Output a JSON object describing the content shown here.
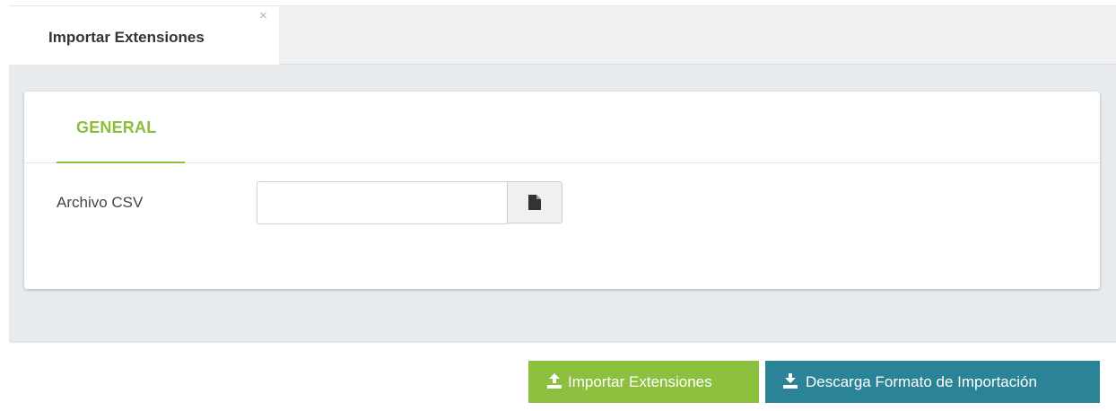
{
  "window_tab": {
    "title": "Importar Extensiones",
    "close_glyph": "×",
    "close_icon": "close-icon"
  },
  "panel": {
    "tabs": [
      {
        "label": "GENERAL",
        "active": true
      }
    ],
    "fields": {
      "csv_file": {
        "label": "Archivo CSV",
        "value": "",
        "placeholder": "",
        "browse_icon": "file-icon"
      }
    }
  },
  "actions": {
    "import": {
      "label": "Importar Extensiones",
      "icon": "upload-icon",
      "color": "#8dc03f"
    },
    "download_format": {
      "label": "Descarga Formato de Importación",
      "icon": "download-icon",
      "color": "#2a8496"
    }
  },
  "colors": {
    "accent_green": "#8dbd3c",
    "accent_teal": "#2a8496",
    "workarea_bg": "#e8ebee"
  }
}
